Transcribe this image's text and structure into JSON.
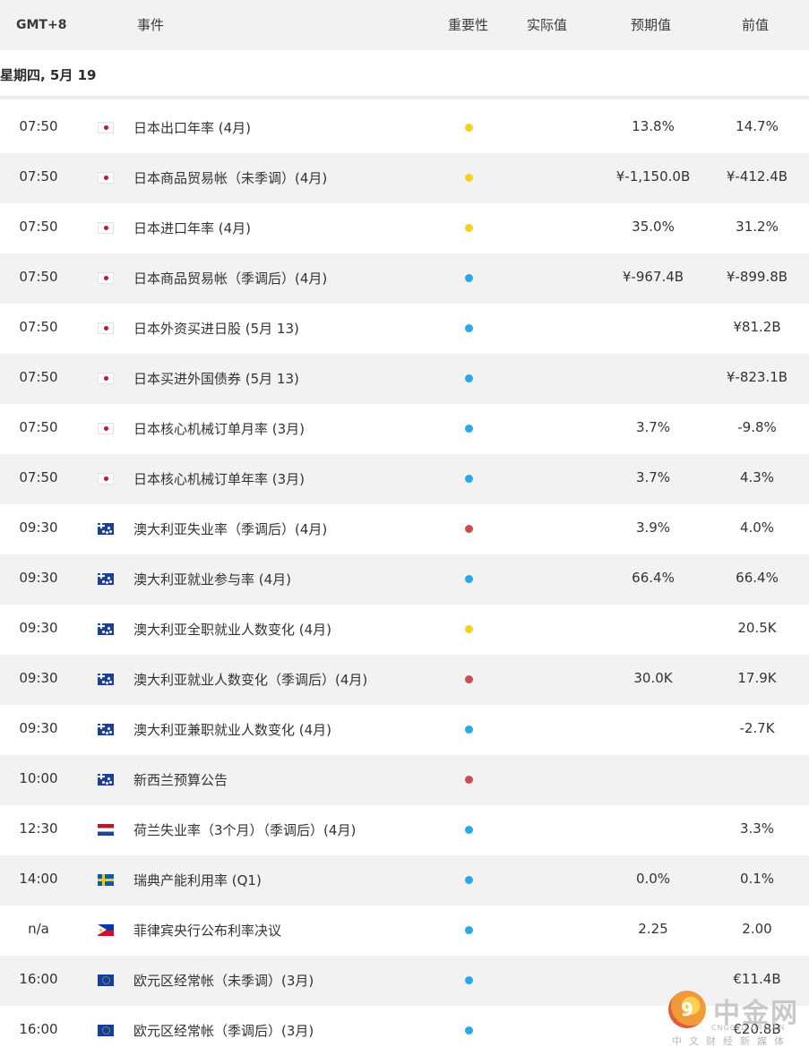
{
  "header": {
    "gmt": "GMT+8",
    "event": "事件",
    "importance": "重要性",
    "actual": "实际值",
    "forecast": "预期值",
    "previous": "前值"
  },
  "date_label": "星期四, 5月 19",
  "colors": {
    "importance_low": "#29a8e6",
    "importance_medium": "#f5d218",
    "importance_high": "#cd4d4d",
    "row_alt_bg": "#f2f2f2"
  },
  "rows": [
    {
      "time": "07:50",
      "flag": "japan-flag-icon",
      "event": "日本出口年率 (4月)",
      "importance": "medium",
      "actual": "",
      "forecast": "13.8%",
      "previous": "14.7%"
    },
    {
      "time": "07:50",
      "flag": "japan-flag-icon",
      "event": "日本商品贸易帐（未季调）(4月)",
      "importance": "medium",
      "actual": "",
      "forecast": "¥-1,150.0B",
      "previous": "¥-412.4B"
    },
    {
      "time": "07:50",
      "flag": "japan-flag-icon",
      "event": "日本进口年率 (4月)",
      "importance": "medium",
      "actual": "",
      "forecast": "35.0%",
      "previous": "31.2%"
    },
    {
      "time": "07:50",
      "flag": "japan-flag-icon",
      "event": "日本商品贸易帐（季调后）(4月)",
      "importance": "low",
      "actual": "",
      "forecast": "¥-967.4B",
      "previous": "¥-899.8B"
    },
    {
      "time": "07:50",
      "flag": "japan-flag-icon",
      "event": "日本外资买进日股 (5月 13)",
      "importance": "low",
      "actual": "",
      "forecast": "",
      "previous": "¥81.2B"
    },
    {
      "time": "07:50",
      "flag": "japan-flag-icon",
      "event": "日本买进外国债券 (5月 13)",
      "importance": "low",
      "actual": "",
      "forecast": "",
      "previous": "¥-823.1B"
    },
    {
      "time": "07:50",
      "flag": "japan-flag-icon",
      "event": "日本核心机械订单月率 (3月)",
      "importance": "low",
      "actual": "",
      "forecast": "3.7%",
      "previous": "-9.8%"
    },
    {
      "time": "07:50",
      "flag": "japan-flag-icon",
      "event": "日本核心机械订单年率 (3月)",
      "importance": "low",
      "actual": "",
      "forecast": "3.7%",
      "previous": "4.3%"
    },
    {
      "time": "09:30",
      "flag": "australia-flag-icon",
      "event": "澳大利亚失业率（季调后）(4月)",
      "importance": "high",
      "actual": "",
      "forecast": "3.9%",
      "previous": "4.0%"
    },
    {
      "time": "09:30",
      "flag": "australia-flag-icon",
      "event": "澳大利亚就业参与率 (4月)",
      "importance": "low",
      "actual": "",
      "forecast": "66.4%",
      "previous": "66.4%"
    },
    {
      "time": "09:30",
      "flag": "australia-flag-icon",
      "event": "澳大利亚全职就业人数变化 (4月)",
      "importance": "medium",
      "actual": "",
      "forecast": "",
      "previous": "20.5K"
    },
    {
      "time": "09:30",
      "flag": "australia-flag-icon",
      "event": "澳大利亚就业人数变化（季调后）(4月)",
      "importance": "high",
      "actual": "",
      "forecast": "30.0K",
      "previous": "17.9K"
    },
    {
      "time": "09:30",
      "flag": "australia-flag-icon",
      "event": "澳大利亚兼职就业人数变化 (4月)",
      "importance": "low",
      "actual": "",
      "forecast": "",
      "previous": "-2.7K"
    },
    {
      "time": "10:00",
      "flag": "new-zealand-flag-icon",
      "event": "新西兰预算公告",
      "importance": "high",
      "actual": "",
      "forecast": "",
      "previous": ""
    },
    {
      "time": "12:30",
      "flag": "netherlands-flag-icon",
      "event": "荷兰失业率（3个月）（季调后）(4月)",
      "importance": "low",
      "actual": "",
      "forecast": "",
      "previous": "3.3%"
    },
    {
      "time": "14:00",
      "flag": "sweden-flag-icon",
      "event": "瑞典产能利用率 (Q1)",
      "importance": "low",
      "actual": "",
      "forecast": "0.0%",
      "previous": "0.1%"
    },
    {
      "time": "n/a",
      "flag": "philippines-flag-icon",
      "event": "菲律宾央行公布利率决议",
      "importance": "low",
      "actual": "",
      "forecast": "2.25",
      "previous": "2.00"
    },
    {
      "time": "16:00",
      "flag": "eu-flag-icon",
      "event": "欧元区经常帐（未季调）(3月)",
      "importance": "low",
      "actual": "",
      "forecast": "",
      "previous": "€11.4B"
    },
    {
      "time": "16:00",
      "flag": "eu-flag-icon",
      "event": "欧元区经常帐（季调后）(3月)",
      "importance": "low",
      "actual": "",
      "forecast": "",
      "previous": "€20.8B"
    }
  ],
  "watermark": {
    "title": "中金网",
    "url": "CNGOLD.ORG.CN",
    "subtitle": "中文财经新媒体"
  }
}
